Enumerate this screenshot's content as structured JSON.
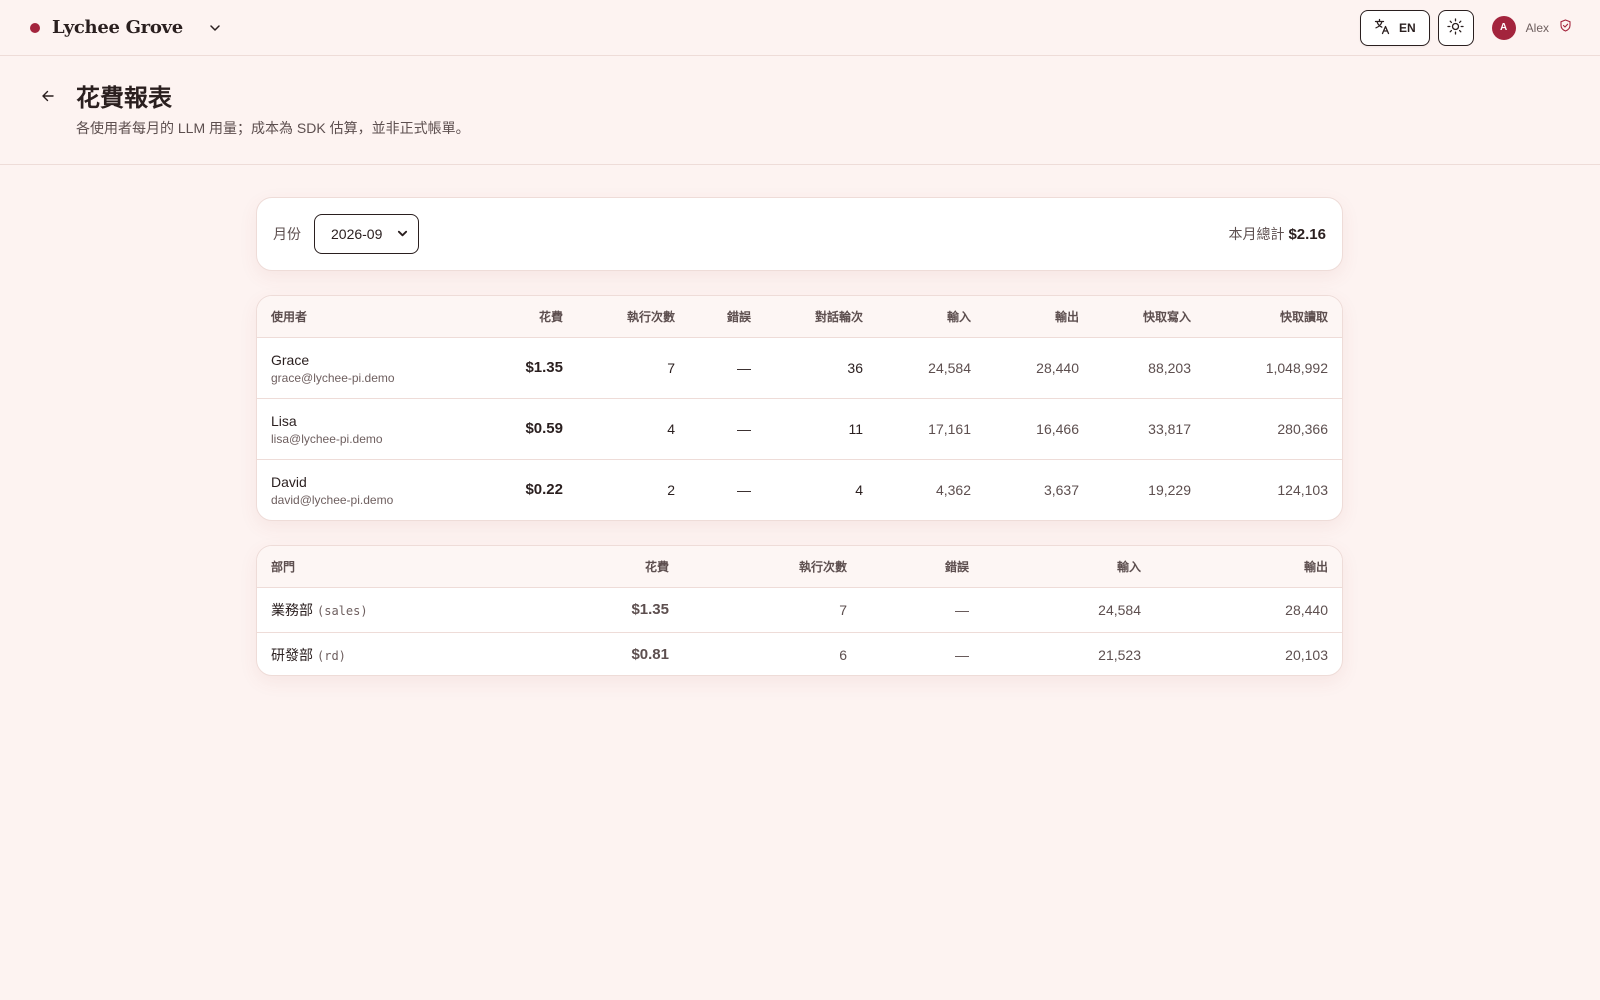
{
  "app": {
    "name": "Lychee Grove"
  },
  "header": {
    "lang_label": "EN",
    "user_initial": "A",
    "user_name": "Alex"
  },
  "page": {
    "title": "花費報表",
    "subtitle": "各使用者每月的 LLM 用量；成本為 SDK 估算，並非正式帳單。"
  },
  "filter": {
    "month_label": "月份",
    "month_value": "2026-09",
    "total_label": "本月總計",
    "total_value": "$2.16"
  },
  "users_table": {
    "columns": [
      "使用者",
      "花費",
      "執行次數",
      "錯誤",
      "對話輪次",
      "輸入",
      "輸出",
      "快取寫入",
      "快取讀取"
    ],
    "rows": [
      {
        "name": "Grace",
        "email": "grace@lychee-pi.demo",
        "cost": "$1.35",
        "runs": "7",
        "errors": "—",
        "turns": "36",
        "input": "24,584",
        "output": "28,440",
        "cache_write": "88,203",
        "cache_read": "1,048,992"
      },
      {
        "name": "Lisa",
        "email": "lisa@lychee-pi.demo",
        "cost": "$0.59",
        "runs": "4",
        "errors": "—",
        "turns": "11",
        "input": "17,161",
        "output": "16,466",
        "cache_write": "33,817",
        "cache_read": "280,366"
      },
      {
        "name": "David",
        "email": "david@lychee-pi.demo",
        "cost": "$0.22",
        "runs": "2",
        "errors": "—",
        "turns": "4",
        "input": "4,362",
        "output": "3,637",
        "cache_write": "19,229",
        "cache_read": "124,103"
      }
    ]
  },
  "dept_table": {
    "columns": [
      "部門",
      "花費",
      "執行次數",
      "錯誤",
      "輸入",
      "輸出"
    ],
    "rows": [
      {
        "name": "業務部",
        "code": "(sales)",
        "cost": "$1.35",
        "runs": "7",
        "errors": "—",
        "input": "24,584",
        "output": "28,440"
      },
      {
        "name": "研發部",
        "code": "(rd)",
        "cost": "$0.81",
        "runs": "6",
        "errors": "—",
        "input": "21,523",
        "output": "20,103"
      }
    ]
  },
  "colors": {
    "accent": "#a3243d",
    "background": "#fdf3f1"
  }
}
